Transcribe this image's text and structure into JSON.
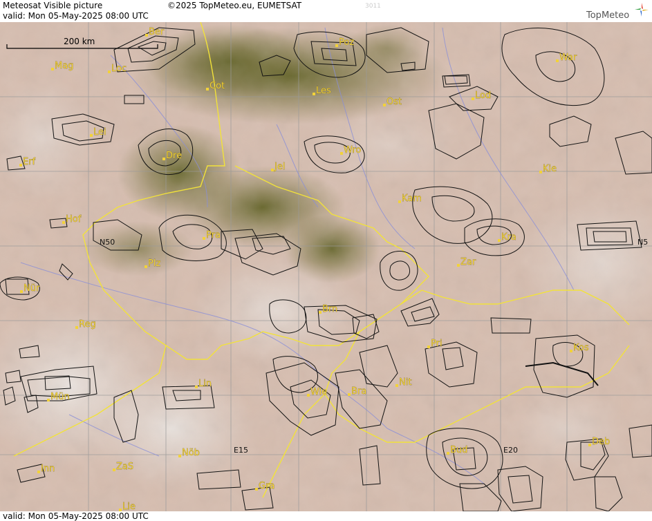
{
  "header": {
    "title": "Meteosat Visible picture",
    "valid": "valid:  Mon  05-May-2025  08:00 UTC",
    "copyright": "©2025 TopMeteo.eu, EUMETSAT",
    "code": "3011",
    "logo": "TopMeteo"
  },
  "footer": {
    "valid": "valid:  Mon  05-May-2025  08:00 UTC"
  },
  "scale": {
    "label": "200 km"
  },
  "grid_labels": {
    "n50_left": "N50",
    "n50_right": "N5",
    "e15": "E15",
    "e20": "E20"
  },
  "cities": [
    {
      "id": "ber",
      "label": "Ber"
    },
    {
      "id": "poz",
      "label": "Poz"
    },
    {
      "id": "war",
      "label": "War"
    },
    {
      "id": "mag",
      "label": "Mag"
    },
    {
      "id": "loc",
      "label": "Loc"
    },
    {
      "id": "cot",
      "label": "Cot"
    },
    {
      "id": "les",
      "label": "Les"
    },
    {
      "id": "ost",
      "label": "Ost"
    },
    {
      "id": "lod",
      "label": "Lod"
    },
    {
      "id": "lei",
      "label": "Lei"
    },
    {
      "id": "dre",
      "label": "Dre"
    },
    {
      "id": "wro",
      "label": "Wro"
    },
    {
      "id": "erf",
      "label": "Erf"
    },
    {
      "id": "jel",
      "label": "Jel"
    },
    {
      "id": "kie",
      "label": "Kie"
    },
    {
      "id": "kam",
      "label": "Kam"
    },
    {
      "id": "hof",
      "label": "Hof"
    },
    {
      "id": "pra",
      "label": "Pra"
    },
    {
      "id": "kra",
      "label": "Kra"
    },
    {
      "id": "plz",
      "label": "Plz"
    },
    {
      "id": "zar",
      "label": "Zar"
    },
    {
      "id": "nur",
      "label": "Nür"
    },
    {
      "id": "brn",
      "label": "Brn"
    },
    {
      "id": "reg",
      "label": "Reg"
    },
    {
      "id": "pri",
      "label": "Pri"
    },
    {
      "id": "kos",
      "label": "Kos"
    },
    {
      "id": "lin",
      "label": "Lin"
    },
    {
      "id": "nit",
      "label": "Nit"
    },
    {
      "id": "mun",
      "label": "Mün"
    },
    {
      "id": "wie",
      "label": "Wie"
    },
    {
      "id": "bra",
      "label": "Bra"
    },
    {
      "id": "nob",
      "label": "Nöb"
    },
    {
      "id": "bud",
      "label": "Bud"
    },
    {
      "id": "deb",
      "label": "Deb"
    },
    {
      "id": "inn",
      "label": "Inn"
    },
    {
      "id": "zas",
      "label": "ZaS"
    },
    {
      "id": "gra",
      "label": "Gra"
    },
    {
      "id": "lie",
      "label": "Lie"
    }
  ],
  "colors": {
    "cloud": "#d9c4b8",
    "land_green": "#6b6a2c",
    "border": "#f2e23a",
    "river": "#8a8fd8",
    "grid": "#9a9a9a",
    "contour": "#111111",
    "city": "#f2d23a"
  }
}
